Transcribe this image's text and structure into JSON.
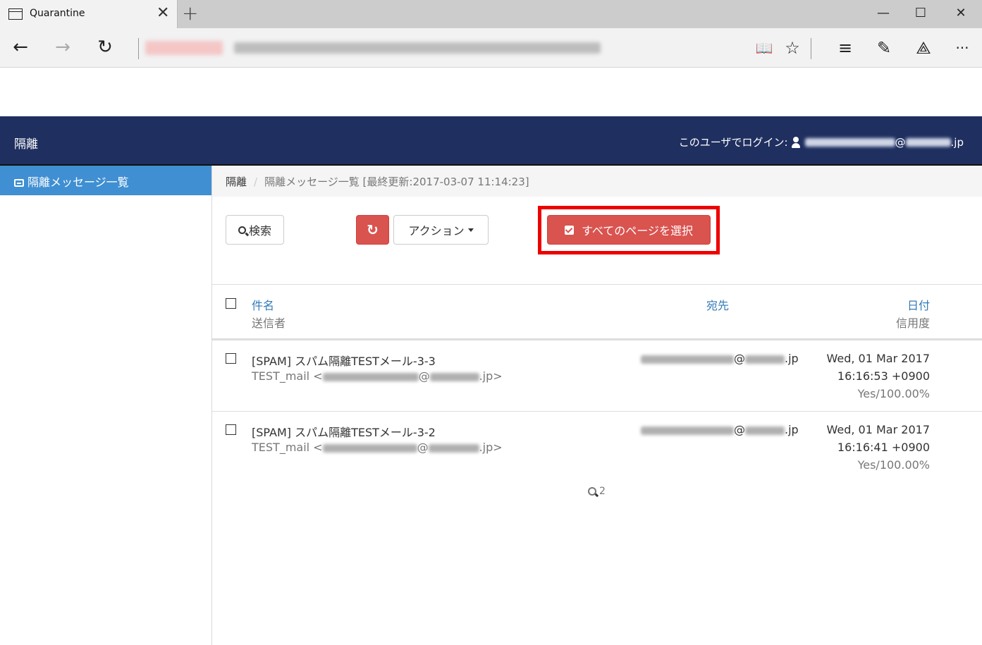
{
  "browser": {
    "tab_title": "Quarantine",
    "tab_close": "✕",
    "new_tab": "+",
    "window_controls": {
      "minimize": "—",
      "maximize": "☐",
      "close": "✕"
    },
    "nav": {
      "back": "←",
      "forward": "→",
      "refresh": "↻"
    },
    "toolbar_icons": {
      "reading_view": "📖",
      "favorite": "☆",
      "hub": "≡",
      "web_note": "✎",
      "share": "⟁",
      "more": "···"
    }
  },
  "header": {
    "title": "隔離",
    "login_label": "このユーザでログイン:",
    "login_email_at": "@",
    "login_email_suffix": ".jp"
  },
  "sidebar": {
    "items": [
      {
        "label": "隔離メッセージ一覧",
        "icon": "inbox-icon",
        "active": true
      }
    ]
  },
  "breadcrumb": {
    "root": "隔離",
    "separator": "/",
    "current": "隔離メッセージ一覧 [最終更新:2017-03-07 11:14:23]"
  },
  "toolbar": {
    "search_label": "検索",
    "refresh_icon": "↻",
    "action_label": "アクション",
    "select_all_label": "すべてのページを選択"
  },
  "table": {
    "headers": {
      "subject": "件名",
      "sender": "送信者",
      "recipient": "宛先",
      "date": "日付",
      "reliability": "信用度"
    },
    "rows": [
      {
        "subject": "[SPAM] スパム隔離TESTメール-3-3",
        "sender_name": "TEST_mail <",
        "sender_at": "@",
        "sender_suffix": ".jp>",
        "recipient_at": "@",
        "recipient_suffix": ".jp",
        "date": "Wed, 01 Mar 2017",
        "time": "16:16:53 +0900",
        "reliability": "Yes/100.00%"
      },
      {
        "subject": "[SPAM] スパム隔離TESTメール-3-2",
        "sender_name": "TEST_mail <",
        "sender_at": "@",
        "sender_suffix": ".jp>",
        "recipient_at": "@",
        "recipient_suffix": ".jp",
        "date": "Wed, 01 Mar 2017",
        "time": "16:16:41 +0900",
        "reliability": "Yes/100.00%"
      }
    ]
  },
  "footer_count": "2",
  "colors": {
    "header_bg": "#1f2f5f",
    "sidebar_active": "#3f8fd2",
    "danger": "#d9534f",
    "link": "#337ab7",
    "highlight": "#ee0000"
  }
}
